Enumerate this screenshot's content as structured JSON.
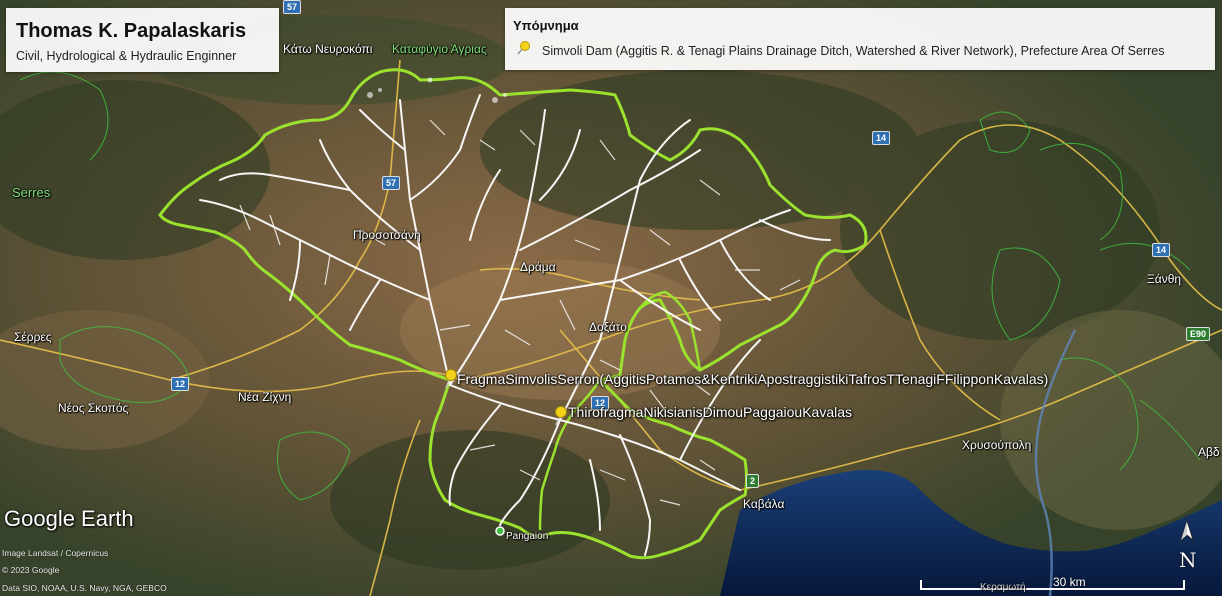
{
  "author": {
    "name": "Thomas K. Papalaskaris",
    "title": "Civil, Hydrological & Hydraulic Enginner"
  },
  "legend": {
    "title": "Υπόμνημα",
    "entry": "Simvoli Dam (Aggitis R. & Tenagi Plains Drainage Ditch, Watershed & River Network), Prefecture Area Of Serres"
  },
  "map_labels": {
    "kato_nevrokopi": "Κάτω Νευροκόπι",
    "katafygio": "Καταφύγιο Άγριας",
    "serres_region": "Serres",
    "prosotsani": "Προσοτσάνη",
    "drama": "Δράμα",
    "doxato": "Δοξάτο",
    "serres": "Σέρρες",
    "nea_zichni": "Νέα Ζίχνη",
    "neos_skopos": "Νέος Σκοπός",
    "xanthi": "Ξάνθη",
    "chrysoupoli": "Χρυσούπολη",
    "avdira": "Αβδ",
    "kavala": "Καβάλα",
    "pangaion": "Pangaion"
  },
  "road_shields": {
    "r57_top": "57",
    "r57": "57",
    "r14": "14",
    "r14_east": "14",
    "r12_west": "12",
    "r12_south": "12",
    "r2": "2",
    "e90": "E90"
  },
  "placemarks": {
    "dam": "FragmaSimvolisSerron(AggitisPotamos&KentrikiApostraggistikiTafrosTTenagiFFilipponKavalas)",
    "flood_gate": "ThirofragmaNikisianisDimouPaggaiouKavalas"
  },
  "branding": {
    "google_earth": "Google Earth",
    "credit_imagery": "Image Landsat / Copernicus",
    "credit_copyright": "© 2023 Google",
    "credit_data": "Data SIO, NOAA, U.S. Navy, NGA, GEBCO"
  },
  "scale": {
    "label": "30 km",
    "sub_label": "Κεραμωτή"
  },
  "compass": {
    "letter": "N"
  },
  "colors": {
    "watershed_outline": "#9be22e",
    "river_network": "#ffffff",
    "roads": "#e8c14a",
    "admin_boundary": "#3fbf3f",
    "sea": "#0e2a5c",
    "pin": "#f5d21a"
  }
}
